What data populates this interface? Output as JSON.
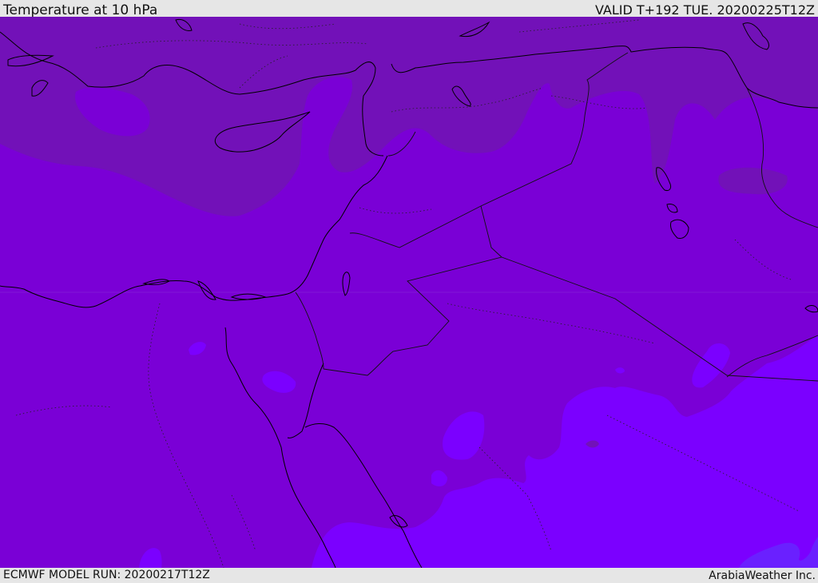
{
  "header": {
    "title": "Temperature at 10 hPa",
    "valid": "VALID T+192 TUE. 20200225T12Z"
  },
  "footer": {
    "model_run": "ECMWF MODEL RUN: 20200217T12Z",
    "credit": "ArabiaWeather Inc."
  },
  "map": {
    "field": "temperature",
    "level": "10 hPa",
    "colors": {
      "warm_band": "#7211b8",
      "base": "#7a00d6",
      "cool": "#7b00ff",
      "coolest": "#6a20ff",
      "coastline": "#000000"
    }
  }
}
